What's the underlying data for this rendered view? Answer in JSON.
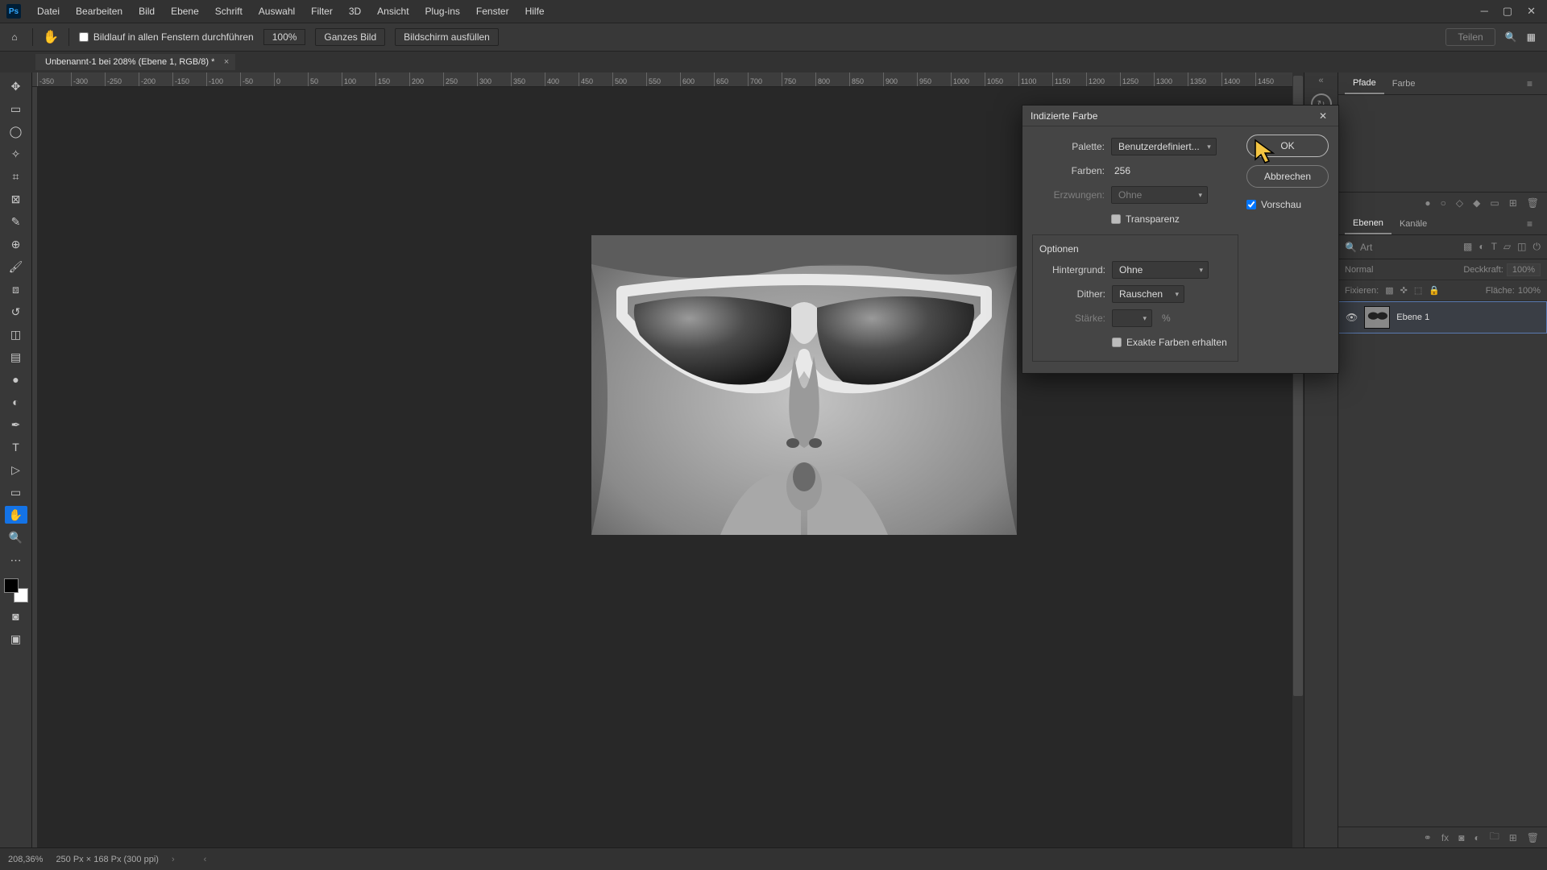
{
  "menubar": [
    "Datei",
    "Bearbeiten",
    "Bild",
    "Ebene",
    "Schrift",
    "Auswahl",
    "Filter",
    "3D",
    "Ansicht",
    "Plug-ins",
    "Fenster",
    "Hilfe"
  ],
  "optionsbar": {
    "scroll_all_label": "Bildlauf in allen Fenstern durchführen",
    "zoom": "100%",
    "btn_whole": "Ganzes Bild",
    "btn_fill": "Bildschirm ausfüllen",
    "share": "Teilen"
  },
  "document_tab": "Unbenannt-1 bei 208% (Ebene 1, RGB/8) *",
  "ruler_ticks": [
    "-350",
    "-300",
    "-250",
    "-200",
    "-150",
    "-100",
    "-50",
    "0",
    "50",
    "100",
    "150",
    "200",
    "250",
    "300",
    "350",
    "400",
    "450",
    "500",
    "550",
    "600",
    "650",
    "700",
    "750",
    "800",
    "850",
    "900",
    "950",
    "1000",
    "1050",
    "1100",
    "1150",
    "1200",
    "1250",
    "1300",
    "1350",
    "1400",
    "1450"
  ],
  "dialog": {
    "title": "Indizierte Farbe",
    "palette_label": "Palette:",
    "palette_value": "Benutzerdefiniert...",
    "colors_label": "Farben:",
    "colors_value": "256",
    "forced_label": "Erzwungen:",
    "forced_value": "Ohne",
    "transparency": "Transparenz",
    "options_label": "Optionen",
    "background_label": "Hintergrund:",
    "background_value": "Ohne",
    "dither_label": "Dither:",
    "dither_value": "Rauschen",
    "strength_label": "Stärke:",
    "percent": "%",
    "exact": "Exakte Farben erhalten",
    "ok": "OK",
    "cancel": "Abbrechen",
    "preview": "Vorschau"
  },
  "panels": {
    "paths_tab": "Pfade",
    "color_tab": "Farbe",
    "layers_tab": "Ebenen",
    "channels_tab": "Kanäle",
    "search_placeholder": "Art",
    "mode_label": "Normal",
    "opacity_label": "Deckkraft:",
    "opacity_value": "100%",
    "fix_label": "Fixieren:",
    "fill_label": "Fläche:",
    "fill_value": "100%",
    "layer_name": "Ebene 1"
  },
  "statusbar": {
    "zoom": "208,36%",
    "docinfo": "250 Px × 168 Px (300 ppi)"
  }
}
